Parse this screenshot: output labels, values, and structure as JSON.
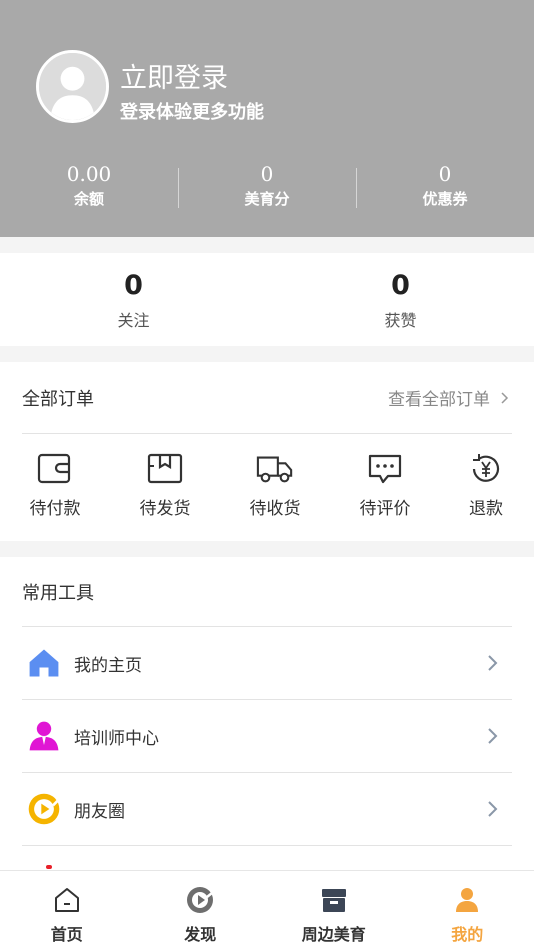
{
  "profile": {
    "login_title": "立即登录",
    "login_subtitle": "登录体验更多功能"
  },
  "stats": [
    {
      "value": "0.00",
      "label": "余额"
    },
    {
      "value": "0",
      "label": "美育分"
    },
    {
      "value": "0",
      "label": "优惠券"
    }
  ],
  "social": [
    {
      "value": "0",
      "label": "关注"
    },
    {
      "value": "0",
      "label": "获赞"
    }
  ],
  "orders": {
    "title": "全部订单",
    "view_all": "查看全部订单",
    "items": [
      {
        "label": "待付款",
        "icon": "wallet-icon"
      },
      {
        "label": "待发货",
        "icon": "box-icon"
      },
      {
        "label": "待收货",
        "icon": "truck-icon"
      },
      {
        "label": "待评价",
        "icon": "comment-icon"
      },
      {
        "label": "退款",
        "icon": "refund-yen-icon"
      }
    ]
  },
  "tools": {
    "title": "常用工具",
    "items": [
      {
        "label": "我的主页",
        "icon": "home-icon",
        "color": "#5b8ef1"
      },
      {
        "label": "培训师中心",
        "icon": "trainer-icon",
        "color": "#e016d4"
      },
      {
        "label": "朋友圈",
        "icon": "moments-icon",
        "color": "#f5b400"
      }
    ]
  },
  "tabbar": {
    "active_color": "#f4a540",
    "items": [
      {
        "label": "首页",
        "icon": "home-tab-icon"
      },
      {
        "label": "发现",
        "icon": "discover-icon"
      },
      {
        "label": "周边美育",
        "icon": "store-icon"
      },
      {
        "label": "我的",
        "icon": "user-icon"
      }
    ]
  }
}
